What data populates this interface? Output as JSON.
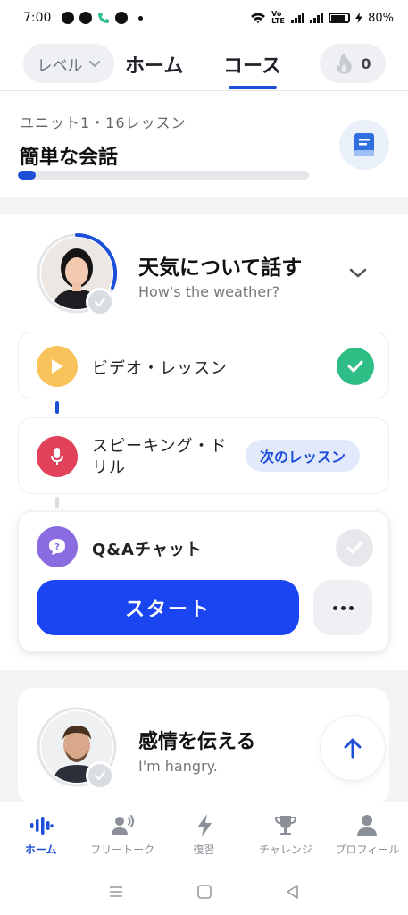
{
  "status_bar": {
    "time": "7:00",
    "battery": "80%",
    "network": "VoLTE"
  },
  "header": {
    "level_label": "レベル",
    "tabs": [
      {
        "label": "ホーム",
        "active": false
      },
      {
        "label": "コース",
        "active": true
      }
    ],
    "streak_count": "0"
  },
  "unit": {
    "subtitle": "ユニット1・16レッスン",
    "title": "簡単な会話",
    "progress": 0.06
  },
  "lesson": {
    "title": "天気について話す",
    "subtitle": "How's the weather?",
    "items": [
      {
        "label": "ビデオ・レッスン",
        "icon": "play-icon",
        "status": "done"
      },
      {
        "label": "スピーキング・ドリル",
        "icon": "microphone-icon",
        "status": "next",
        "badge": "次のレッスン"
      },
      {
        "label": "Q&Aチャット",
        "icon": "chat-question-icon",
        "status": "todo"
      }
    ],
    "start_label": "スタート"
  },
  "next_unit": {
    "title": "感情を伝える",
    "subtitle": "I'm hangry."
  },
  "bottom_nav": [
    {
      "label": "ホーム",
      "icon": "soundwave-icon",
      "active": true
    },
    {
      "label": "フリートーク",
      "icon": "person-speaking-icon",
      "active": false
    },
    {
      "label": "復習",
      "icon": "lightning-icon",
      "active": false
    },
    {
      "label": "チャレンジ",
      "icon": "trophy-icon",
      "active": false
    },
    {
      "label": "プロフィール",
      "icon": "person-icon",
      "active": false
    }
  ],
  "colors": {
    "accent": "#1d4ed8",
    "start_button": "#1a45f0",
    "success": "#2ebd85",
    "play": "#f7c35a",
    "mic": "#e2415a",
    "chat": "#8b6be0"
  }
}
